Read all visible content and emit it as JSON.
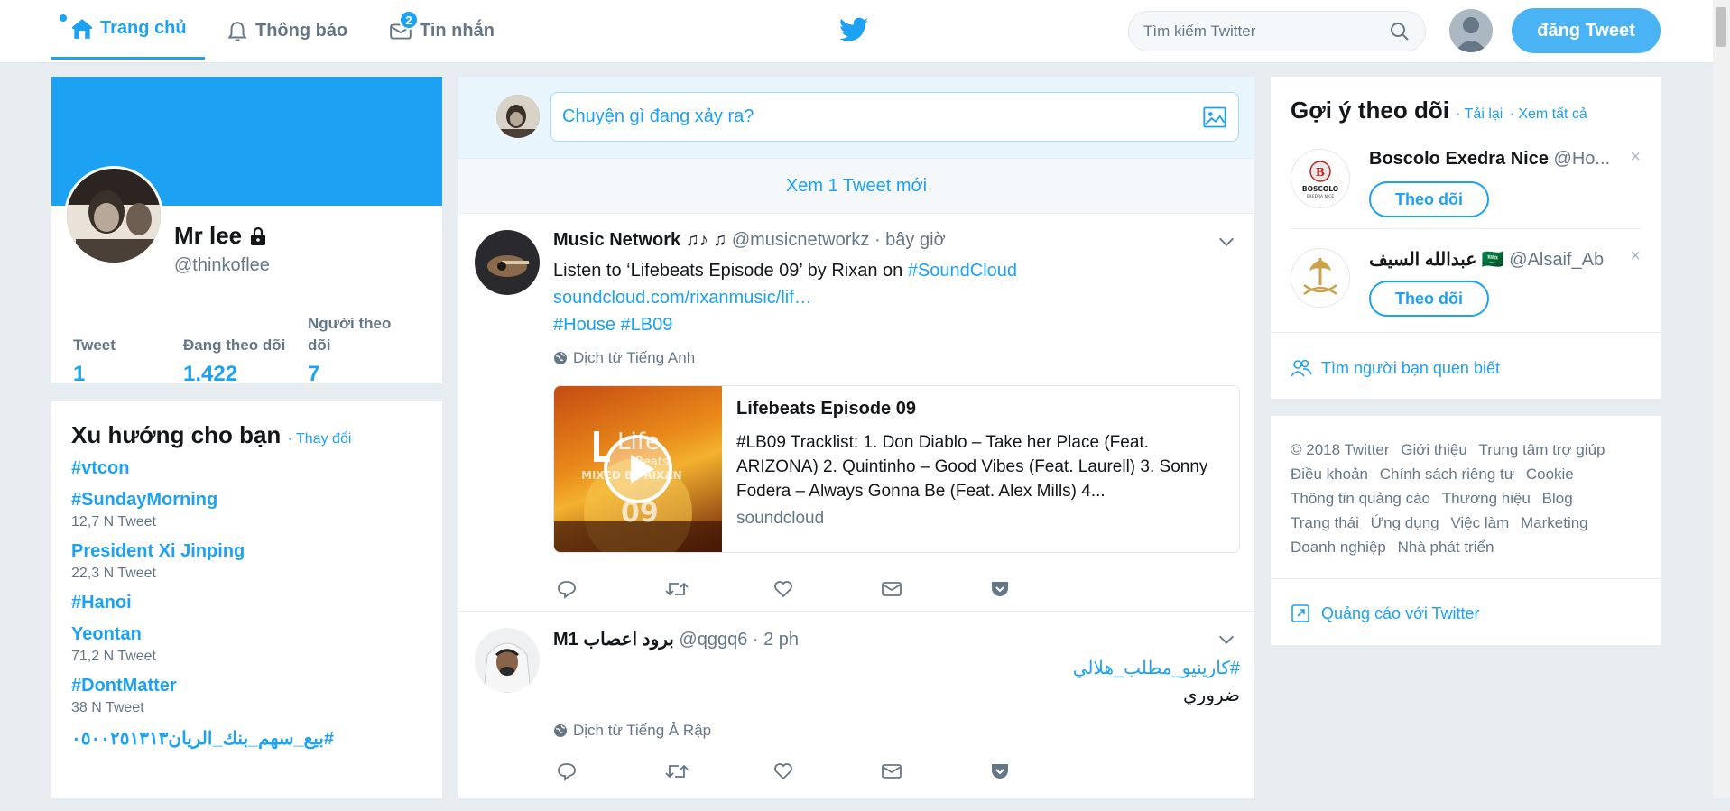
{
  "nav": {
    "home": "Trang chủ",
    "notifications": "Thông báo",
    "messages": "Tin nhắn",
    "messages_badge": "2",
    "search_placeholder": "Tìm kiếm Twitter",
    "tweet_button": "đăng Tweet"
  },
  "profile": {
    "name": "Mr lee",
    "handle": "@thinkoflee",
    "stats": [
      {
        "label": "Tweet",
        "value": "1"
      },
      {
        "label": "Đang theo dõi",
        "value": "1.422"
      },
      {
        "label": "Người theo dõi",
        "value": "7"
      }
    ]
  },
  "trends": {
    "title": "Xu hướng cho bạn",
    "change": "· Thay đổi",
    "items": [
      {
        "topic": "#vtcon",
        "count": ""
      },
      {
        "topic": "#SundayMorning",
        "count": "12,7 N Tweet"
      },
      {
        "topic": "President Xi Jinping",
        "count": "22,3 N Tweet"
      },
      {
        "topic": "#Hanoi",
        "count": ""
      },
      {
        "topic": "Yeontan",
        "count": "71,2 N Tweet"
      },
      {
        "topic": "#DontMatter",
        "count": "38 N Tweet"
      },
      {
        "topic": "#بيع_سهم_بنك_الريان٠٥٠٠٢٥١٣١٣",
        "count": ""
      }
    ]
  },
  "composer": {
    "placeholder": "Chuyện gì đang xảy ra?"
  },
  "new_tweets": "Xem 1 Tweet mới",
  "tweets": [
    {
      "name": "Music Network ♫♪ ♫",
      "handle": "@musicnetworkz",
      "time": "· bây giờ",
      "text_prefix": "Listen to ‘Lifebeats Episode 09’ by Rixan on ",
      "text_hashtag": "#SoundCloud",
      "link": "soundcloud.com/rixanmusic/lif…",
      "hashtags": "#House #LB09",
      "translate": "Dịch từ Tiếng Anh",
      "card": {
        "title": "Lifebeats Episode 09",
        "desc": "#LB09 Tracklist: 1. Don Diablo – Take her Place (Feat. ARIZONA) 2. Quintinho – Good Vibes (Feat. Laurell) 3. Sonny Fodera – Always Gonna Be (Feat. Alex Mills) 4...",
        "source": "soundcloud",
        "thumb_text_1": "Life",
        "thumb_text_2": "Beats",
        "thumb_text_3": "MIXED BY RIXAN",
        "thumb_text_4": "09"
      }
    },
    {
      "name": "برود اعصاب M1",
      "handle": "@qggq6",
      "time": "· 2 ph",
      "hashtag": "#كارينيو_مطلب_هلالي",
      "text": "ضروري",
      "translate": "Dịch từ Tiếng Ả Rập"
    }
  ],
  "who_to_follow": {
    "title": "Gợi ý theo dõi",
    "reload": "· Tải lại",
    "view_all": "· Xem tất cả",
    "follow_label": "Theo dõi",
    "suggestions": [
      {
        "name": "Boscolo Exedra Nice",
        "handle": "@Ho...",
        "logo_text": "BOSCOLO",
        "logo_sub": "EXEDRA NICE"
      },
      {
        "name": "عبدالله السيف",
        "flag": "🇸🇦",
        "handle": "@Alsaif_Ab"
      }
    ],
    "find_friends": "Tìm người bạn quen biết"
  },
  "footer": {
    "links": [
      "© 2018 Twitter",
      "Giới thiệu",
      "Trung tâm trợ giúp",
      "Điều khoản",
      "Chính sách riêng tư",
      "Cookie",
      "Thông tin quảng cáo",
      "Thương hiệu",
      "Blog",
      "Trạng thái",
      "Ứng dụng",
      "Việc làm",
      "Marketing",
      "Doanh nghiệp",
      "Nhà phát triển"
    ],
    "ads": "Quảng cáo với Twitter"
  },
  "colors": {
    "accent": "#1da1f2",
    "background": "#e6ecf0",
    "muted": "#657786"
  }
}
